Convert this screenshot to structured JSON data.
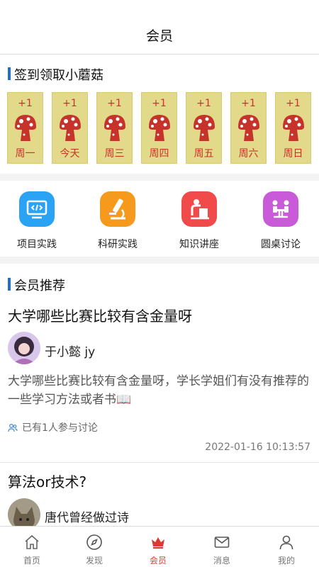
{
  "header": {
    "title": "会员"
  },
  "checkin": {
    "title": "签到领取小蘑菇",
    "days": [
      {
        "plus": "+1",
        "label": "周一"
      },
      {
        "plus": "+1",
        "label": "今天"
      },
      {
        "plus": "+1",
        "label": "周三"
      },
      {
        "plus": "+1",
        "label": "周四"
      },
      {
        "plus": "+1",
        "label": "周五"
      },
      {
        "plus": "+1",
        "label": "周六"
      },
      {
        "plus": "+1",
        "label": "周日"
      }
    ]
  },
  "categories": [
    {
      "label": "项目实践",
      "icon": "code-screen-icon",
      "color": "#2aa3f4"
    },
    {
      "label": "科研实践",
      "icon": "microscope-icon",
      "color": "#f59a1c"
    },
    {
      "label": "知识讲座",
      "icon": "lecture-icon",
      "color": "#f04a4a"
    },
    {
      "label": "圆桌讨论",
      "icon": "roundtable-icon",
      "color": "#c95ad8"
    }
  ],
  "recommend": {
    "title": "会员推荐",
    "posts": [
      {
        "title": "大学哪些比赛比较有含金量呀",
        "author": "于小懿 jy",
        "body": "大学哪些比赛比较有含金量呀，学长学姐们有没有推荐的一些学习方法或者书📖",
        "participants": "已有1人参与讨论",
        "timestamp": "2022-01-16 10:13:57"
      },
      {
        "title": "算法or技术?",
        "author": "唐代曾经做过诗"
      }
    ]
  },
  "tabbar": {
    "tabs": [
      {
        "label": "首页",
        "icon": "home-icon"
      },
      {
        "label": "发现",
        "icon": "compass-icon"
      },
      {
        "label": "会员",
        "icon": "crown-icon"
      },
      {
        "label": "消息",
        "icon": "mail-icon"
      },
      {
        "label": "我的",
        "icon": "person-icon"
      }
    ],
    "active": 2,
    "active_color": "#d93a32"
  }
}
